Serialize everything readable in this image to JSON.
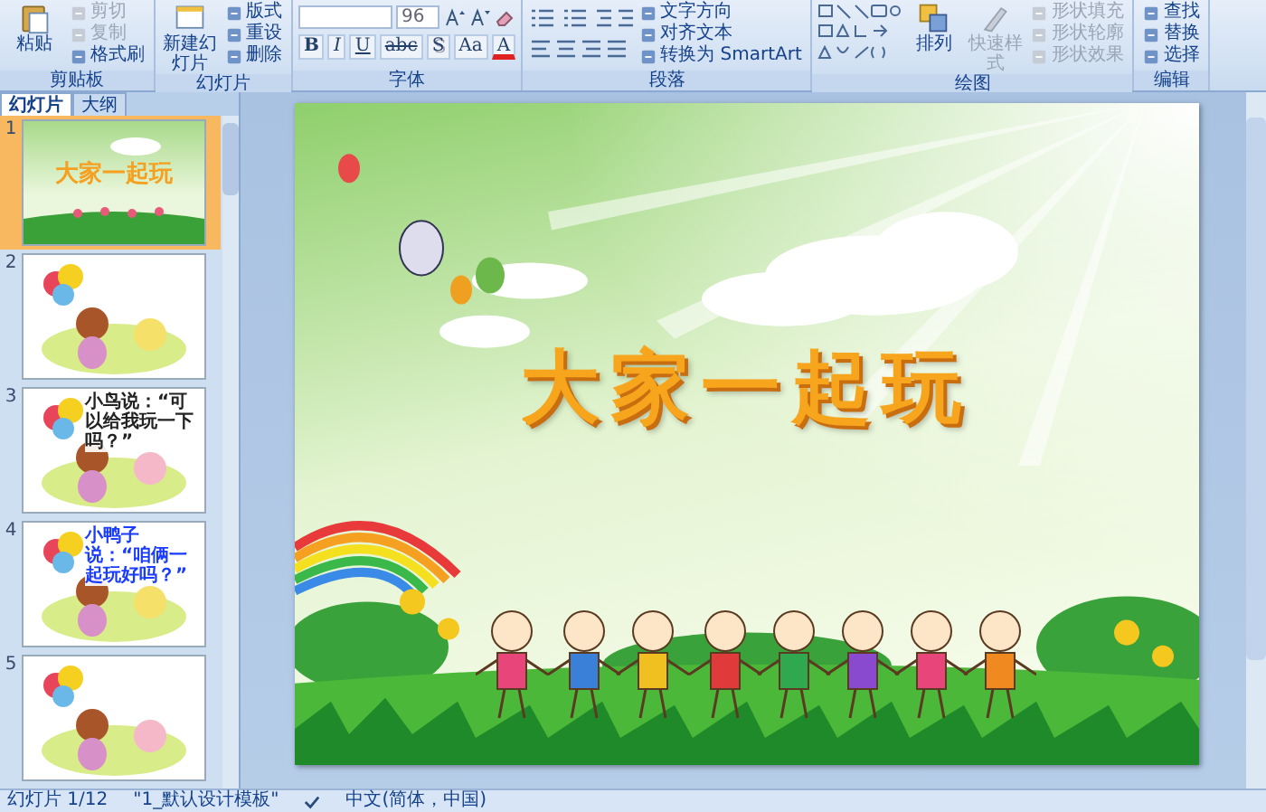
{
  "ribbon": {
    "groups": [
      {
        "title": "剪贴板",
        "kind": "standard",
        "large": [
          {
            "label": "粘贴",
            "disabled": false
          }
        ],
        "small": [
          {
            "label": "剪切",
            "disabled": true
          },
          {
            "label": "复制",
            "disabled": true
          },
          {
            "label": "格式刷",
            "disabled": false
          }
        ]
      },
      {
        "title": "幻灯片",
        "kind": "standard",
        "large": [
          {
            "label": "新建幻灯片",
            "disabled": false
          }
        ],
        "small": [
          {
            "label": "版式",
            "disabled": false
          },
          {
            "label": "重设",
            "disabled": false
          },
          {
            "label": "删除",
            "disabled": false
          }
        ]
      },
      {
        "title": "字体",
        "kind": "font",
        "size_field": {
          "value": "96"
        },
        "tools": [
          {
            "label": "B"
          },
          {
            "label": "I"
          },
          {
            "label": "U"
          },
          {
            "label": "abc"
          },
          {
            "label": "S"
          },
          {
            "label": "Aa"
          },
          {
            "label": "A"
          }
        ]
      },
      {
        "title": "段落",
        "kind": "paragraph",
        "small": [
          {
            "label": "文字方向",
            "disabled": false
          },
          {
            "label": "对齐文本",
            "disabled": false
          },
          {
            "label": "转换为 SmartArt",
            "disabled": false
          }
        ]
      },
      {
        "title": "绘图",
        "kind": "drawing",
        "large": [
          {
            "label": "排列",
            "disabled": false
          },
          {
            "label": "快速样式",
            "disabled": true
          }
        ],
        "small": [
          {
            "label": "形状填充",
            "disabled": true
          },
          {
            "label": "形状轮廓",
            "disabled": true
          },
          {
            "label": "形状效果",
            "disabled": true
          }
        ]
      },
      {
        "title": "编辑",
        "kind": "standard",
        "small": [
          {
            "label": "查找",
            "disabled": false
          },
          {
            "label": "替换",
            "disabled": false
          },
          {
            "label": "选择",
            "disabled": false
          }
        ]
      }
    ]
  },
  "panel": {
    "tabs": [
      {
        "label": "幻灯片",
        "selected": true
      },
      {
        "label": "大纲",
        "selected": false
      }
    ],
    "slides": [
      {
        "number": "1",
        "kind": "title",
        "selected": true,
        "title": "大家一起玩"
      },
      {
        "number": "2",
        "kind": "picture",
        "selected": false
      },
      {
        "number": "3",
        "kind": "caption",
        "selected": false,
        "caption": "小鸟说：“可以给我玩一下吗？”",
        "color": "#222222"
      },
      {
        "number": "4",
        "kind": "caption",
        "selected": false,
        "caption": "小鸭子说：“咱俩一起玩好吗？”",
        "color": "#1a3cff"
      },
      {
        "number": "5",
        "kind": "picture",
        "selected": false
      }
    ]
  },
  "slide": {
    "title": "大家一起玩"
  },
  "status_bar": {
    "slide": "幻灯片 1/12",
    "theme": "\"1_默认设计模板\"",
    "language": "中文(简体，中国)"
  }
}
